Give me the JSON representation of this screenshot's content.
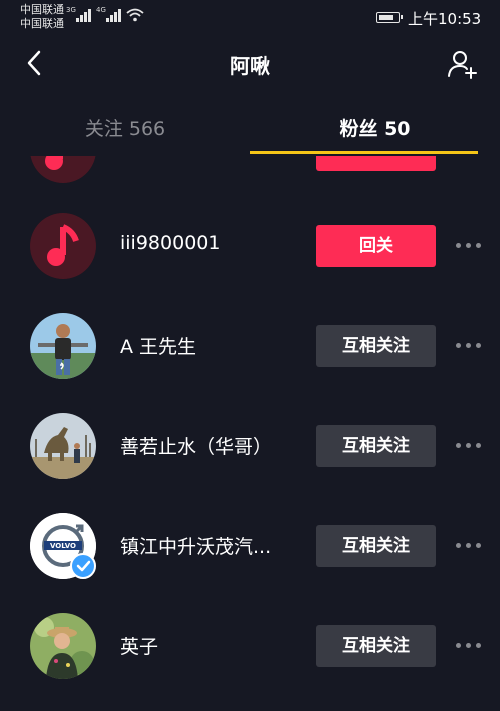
{
  "status_bar": {
    "carrier_1": "中国联通",
    "carrier_2": "中国联通",
    "net_1": "3G",
    "net_2": "4G",
    "time": "上午10:53"
  },
  "header": {
    "title": "阿啾",
    "back_icon": "chevron-left-icon",
    "add_icon": "add-user-icon"
  },
  "tabs": [
    {
      "label": "关注 566"
    },
    {
      "label": "粉丝 50"
    }
  ],
  "colors": {
    "background": "#161823",
    "accent_red": "#fe2c55",
    "tab_underline": "#f5c518",
    "button_gray": "#393b44",
    "verified_blue": "#3aa0ff"
  },
  "followers": [
    {
      "name": "",
      "button": "",
      "button_style": "red",
      "avatar": "music-note-icon"
    },
    {
      "name": "iii9800001",
      "button": "回关",
      "button_style": "red",
      "avatar": "music-note-icon"
    },
    {
      "name": "A 王先生",
      "button": "互相关注",
      "button_style": "gray",
      "avatar": "photo-man"
    },
    {
      "name": "善若止水（华哥）",
      "button": "互相关注",
      "button_style": "gray",
      "avatar": "photo-dinosaur"
    },
    {
      "name": "镇江中升沃茂汽...",
      "button": "互相关注",
      "button_style": "gray",
      "avatar": "volvo-logo",
      "verified": true
    },
    {
      "name": "英子",
      "button": "互相关注",
      "button_style": "gray",
      "avatar": "photo-woman"
    }
  ]
}
